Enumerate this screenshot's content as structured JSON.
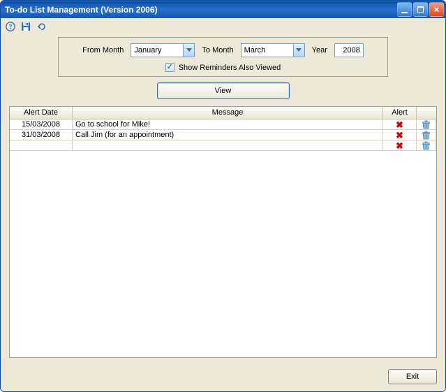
{
  "window": {
    "title": "To-do List Management (Version 2006)"
  },
  "filter": {
    "from_label": "From Month",
    "from_value": "January",
    "to_label": "To Month",
    "to_value": "March",
    "year_label": "Year",
    "year_value": "2008",
    "checkbox_label": "Show Reminders Also Viewed",
    "checkbox_checked": true
  },
  "view_button": "View",
  "grid": {
    "headers": {
      "date": "Alert Date",
      "message": "Message",
      "alert": "Alert"
    },
    "rows": [
      {
        "date": "15/03/2008",
        "message": "Go to school for Mike!"
      },
      {
        "date": "31/03/2008",
        "message": "Call Jim (for an appointment)"
      },
      {
        "date": "",
        "message": ""
      }
    ]
  },
  "exit_button": "Exit"
}
